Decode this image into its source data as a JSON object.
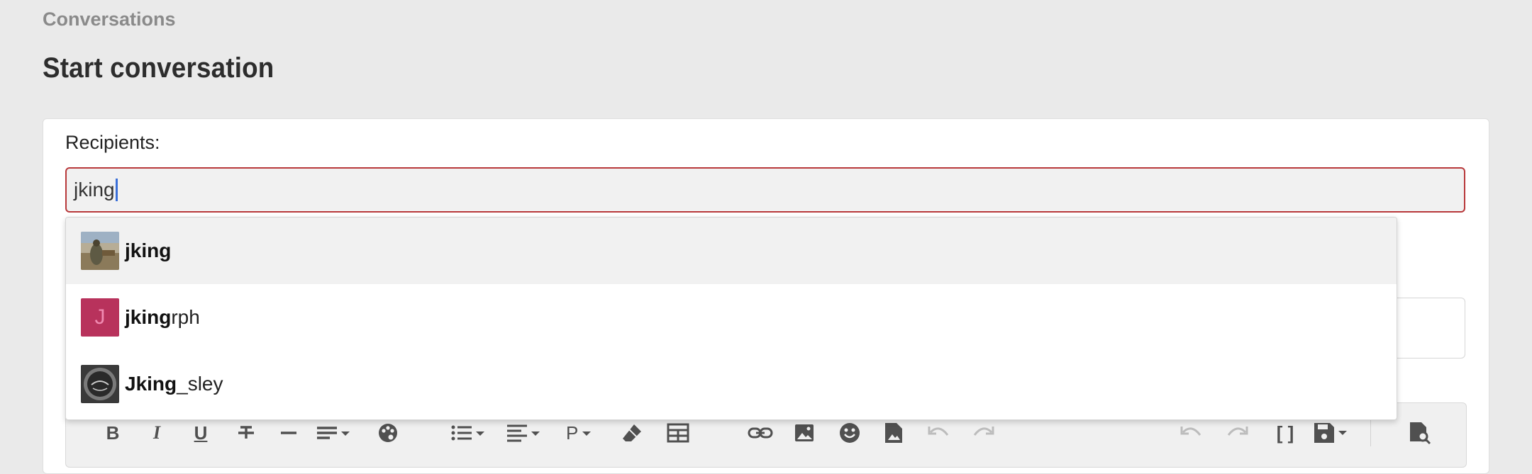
{
  "breadcrumb": "Conversations",
  "page_title": "Start conversation",
  "recipients": {
    "label": "Recipients:",
    "input_value": "jking"
  },
  "suggestions": [
    {
      "match": "jking",
      "rest": "",
      "avatar": "photo"
    },
    {
      "match": "jking",
      "rest": "rph",
      "avatar": "letter",
      "letter": "J",
      "avatar_bg": "#b8325c"
    },
    {
      "match": "Jking",
      "rest": "_sley",
      "avatar": "logo"
    }
  ],
  "toolbar": {
    "icons": [
      "bold-icon",
      "italic-icon",
      "underline-icon",
      "strikethrough-icon",
      "horizontal-line-icon",
      "text-size-icon",
      "palette-icon",
      "list-icon",
      "align-icon",
      "paragraph-icon",
      "eraser-icon",
      "table-icon",
      "link-icon",
      "image-icon",
      "emoji-icon",
      "media-icon",
      "undo-icon",
      "redo-icon",
      "undo-icon",
      "redo-icon",
      "brackets-icon",
      "save-draft-icon",
      "preview-icon"
    ],
    "bold": "B",
    "italic": "I",
    "underline": "U",
    "paragraph": "P",
    "brackets": "[ ]"
  },
  "colors": {
    "input_border": "#b8383a",
    "caret": "#3a6fd8",
    "avatar_pink": "#b8325c"
  }
}
